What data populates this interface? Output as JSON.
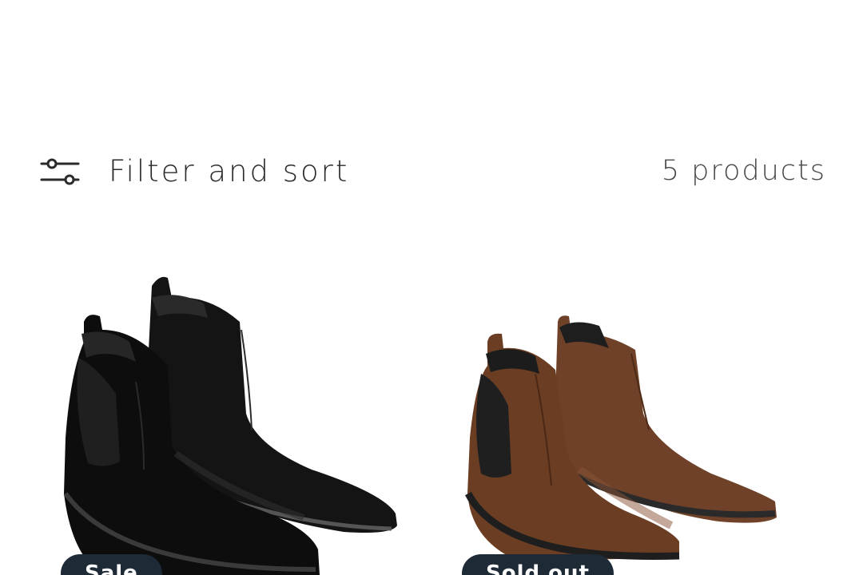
{
  "toolbar": {
    "filter_label": "Filter and sort",
    "product_count": "5 products"
  },
  "products": [
    {
      "badge": "Sale",
      "color": "#111111",
      "color_name": "black"
    },
    {
      "badge": "Sold out",
      "color": "#6b3e24",
      "color_name": "brown"
    }
  ],
  "colors": {
    "badge_bg": "#1f2a37",
    "text": "#2b2b2b"
  }
}
